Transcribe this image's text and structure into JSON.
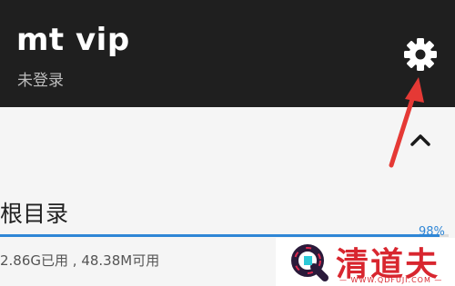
{
  "header": {
    "title": "mt vip",
    "subtitle": "未登录",
    "background": "#1f1f1f",
    "icons": {
      "theme": "moon-icon",
      "settings": "gear-icon"
    }
  },
  "annotation": {
    "color": "#e53935",
    "icon": "red-arrow"
  },
  "content": {
    "collapse_icon": "chevron-up-icon",
    "folder_title": "根目录",
    "storage_used_fraction": 0.98,
    "storage_percent": "98%",
    "storage_info": "2.86G已用 , 48.38M可用",
    "accent": "#2f86d6"
  },
  "watermark": {
    "text": "清道夫",
    "url": "— WWW.QDFUJI.COM —",
    "color": "#d8262f"
  }
}
